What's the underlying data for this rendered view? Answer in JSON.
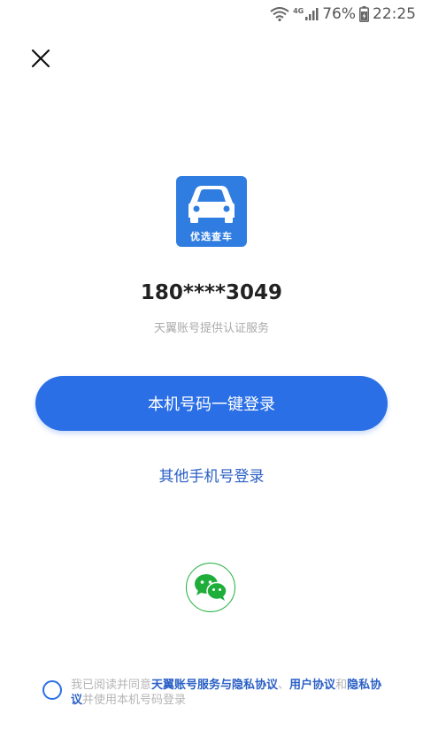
{
  "status_bar": {
    "battery_percent": "76%",
    "time": "22:25",
    "network": "4G",
    "icons": [
      "wifi-icon",
      "signal-icon",
      "battery-icon"
    ]
  },
  "header": {
    "close_icon": "close-icon"
  },
  "app_logo": {
    "text": "优选查车",
    "icon": "car-icon"
  },
  "account": {
    "masked_phone": "180****3049",
    "auth_note": "天翼账号提供认证服务"
  },
  "actions": {
    "one_click_login": "本机号码一键登录",
    "other_phone_login": "其他手机号登录",
    "wechat_icon": "wechat-icon"
  },
  "agreement": {
    "prefix": "我已阅读并同意",
    "link1": "天翼账号服务与隐私协议",
    "sep": "、",
    "link2": "用户协议",
    "and": "和",
    "link3": "隐私协议",
    "suffix": "并使用本机号码登录"
  },
  "colors": {
    "primary": "#2a6fe6",
    "link": "#2a5fc6",
    "wechat": "#1fae3a",
    "logo_bg": "#2f7de1"
  }
}
